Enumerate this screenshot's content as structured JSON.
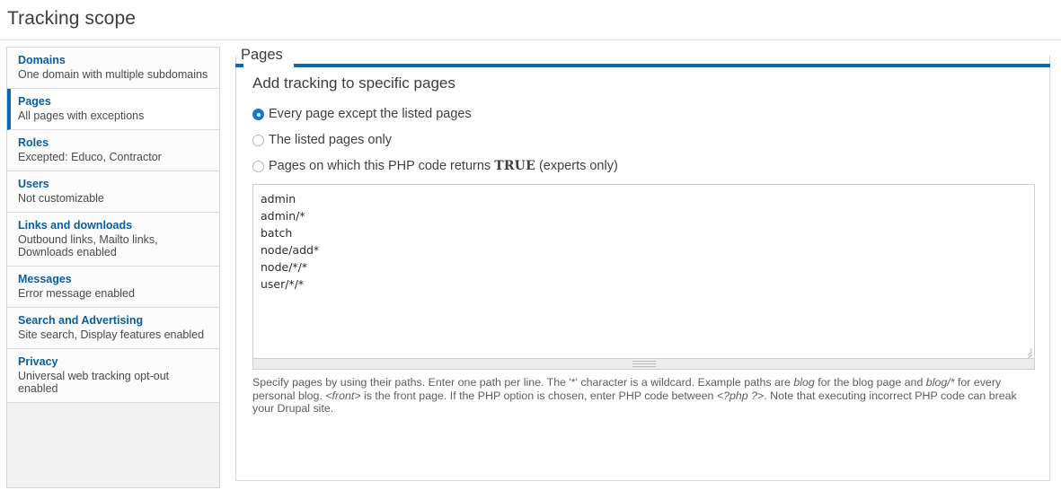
{
  "header": {
    "title": "Tracking scope"
  },
  "sidebar": {
    "items": [
      {
        "title": "Domains",
        "summary": "One domain with multiple subdomains",
        "selected": false
      },
      {
        "title": "Pages",
        "summary": "All pages with exceptions",
        "selected": true
      },
      {
        "title": "Roles",
        "summary": "Excepted: Educo, Contractor",
        "selected": false
      },
      {
        "title": "Users",
        "summary": "Not customizable",
        "selected": false
      },
      {
        "title": "Links and downloads",
        "summary": "Outbound links, Mailto links, Downloads enabled",
        "selected": false
      },
      {
        "title": "Messages",
        "summary": "Error message enabled",
        "selected": false
      },
      {
        "title": "Search and Advertising",
        "summary": "Site search, Display features enabled",
        "selected": false
      },
      {
        "title": "Privacy",
        "summary": "Universal web tracking opt-out enabled",
        "selected": false
      }
    ]
  },
  "panel": {
    "legend": "Pages",
    "heading": "Add tracking to specific pages",
    "radios": [
      {
        "label": "Every page except the listed pages",
        "checked": true
      },
      {
        "label": "The listed pages only",
        "checked": false
      },
      {
        "label_before": "Pages on which this PHP code returns ",
        "code": "TRUE",
        "label_after": " (experts only)",
        "checked": false
      }
    ],
    "textarea": {
      "value": "admin\nadmin/*\nbatch\nnode/add*\nnode/*/*\nuser/*/*",
      "placeholder": ""
    },
    "description": {
      "part1": "Specify pages by using their paths. Enter one path per line. The '*' character is a wildcard. Example paths are ",
      "em1": "blog",
      "part2": " for the blog page and ",
      "em2": "blog/*",
      "part3": " for every personal blog. ",
      "em3": "<front>",
      "part4": " is the front page. If the PHP option is chosen, enter PHP code between ",
      "em4": "<?php ?>",
      "part5": ". Note that executing incorrect PHP code can break your Drupal site."
    }
  },
  "colors": {
    "accent": "#0c6ab2",
    "link": "#0b5d9e",
    "radio_checked": "#1578cf"
  }
}
